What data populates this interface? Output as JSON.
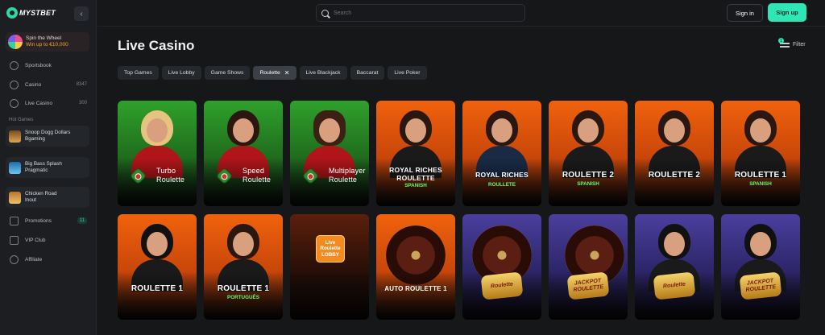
{
  "brand": {
    "name": "MYSTBET",
    "accent": "#2fe6b5"
  },
  "sidebar": {
    "collapse_icon": "chevron-left-icon",
    "promo": {
      "title": "Spin the Wheel",
      "subtitle": "Win up to €10,000"
    },
    "nav": [
      {
        "label": "Sportsbook",
        "icon": "ball-icon",
        "count": ""
      },
      {
        "label": "Casino",
        "icon": "spade-icon",
        "count": "8347"
      },
      {
        "label": "Live Casino",
        "icon": "live-icon",
        "count": "300"
      }
    ],
    "hot_games_label": "Hot Games",
    "hot_games": [
      {
        "name": "Snoop Dogg Dollars",
        "provider": "Bgaming"
      },
      {
        "name": "Big Bass Splash",
        "provider": "Pragmatic"
      },
      {
        "name": "Chicken Road",
        "provider": "Inout"
      }
    ],
    "bottom_nav": [
      {
        "label": "Promotions",
        "icon": "gift-icon",
        "badge": "11"
      },
      {
        "label": "VIP Club",
        "icon": "crown-icon",
        "badge": ""
      },
      {
        "label": "Affiliate",
        "icon": "users-icon",
        "badge": ""
      }
    ]
  },
  "header": {
    "search_placeholder": "Search",
    "signin_label": "Sign in",
    "signup_label": "Sign up"
  },
  "main": {
    "title": "Live Casino",
    "filter_label": "Filter",
    "filter_count": "1",
    "tabs": [
      {
        "label": "Top Games",
        "active": false
      },
      {
        "label": "Live Lobby",
        "active": false
      },
      {
        "label": "Game Shows",
        "active": false
      },
      {
        "label": "Roulette",
        "active": true
      },
      {
        "label": "Live Blackjack",
        "active": false
      },
      {
        "label": "Baccarat",
        "active": false
      },
      {
        "label": "Live Poker",
        "active": false
      }
    ],
    "games": [
      {
        "title": "Turbo\nRoulette",
        "sub": "",
        "theme": "green"
      },
      {
        "title": "Speed\nRoulette",
        "sub": "",
        "theme": "green"
      },
      {
        "title": "Multiplayer\nRoulette",
        "sub": "",
        "theme": "green"
      },
      {
        "title": "ROYAL RICHES\nROULETTE",
        "sub": "SPANISH",
        "theme": "orange"
      },
      {
        "title": "ROYAL RICHES",
        "sub": "ROULLETE",
        "theme": "orange"
      },
      {
        "title": "ROULETTE 2",
        "sub": "SPANISH",
        "theme": "orange"
      },
      {
        "title": "ROULETTE 2",
        "sub": "",
        "theme": "orange"
      },
      {
        "title": "ROULETTE 1",
        "sub": "SPANISH",
        "theme": "orange"
      },
      {
        "title": "ROULETTE 1",
        "sub": "",
        "theme": "orange"
      },
      {
        "title": "ROULETTE 1",
        "sub": "PORTUGUÊS",
        "theme": "orange"
      },
      {
        "title": "Live\nRoulette\nLOBBY",
        "sub": "",
        "theme": "lobby"
      },
      {
        "title": "AUTO ROULETTE 1",
        "sub": "",
        "theme": "wheel"
      },
      {
        "title": "Roulette",
        "sub": "",
        "theme": "purple-wheel"
      },
      {
        "title": "JACKPOT\nROULETTE",
        "sub": "",
        "theme": "purple-wheel"
      },
      {
        "title": "Roulette",
        "sub": "",
        "theme": "purple"
      },
      {
        "title": "JACKPOT\nROULETTE",
        "sub": "",
        "theme": "purple"
      }
    ]
  }
}
